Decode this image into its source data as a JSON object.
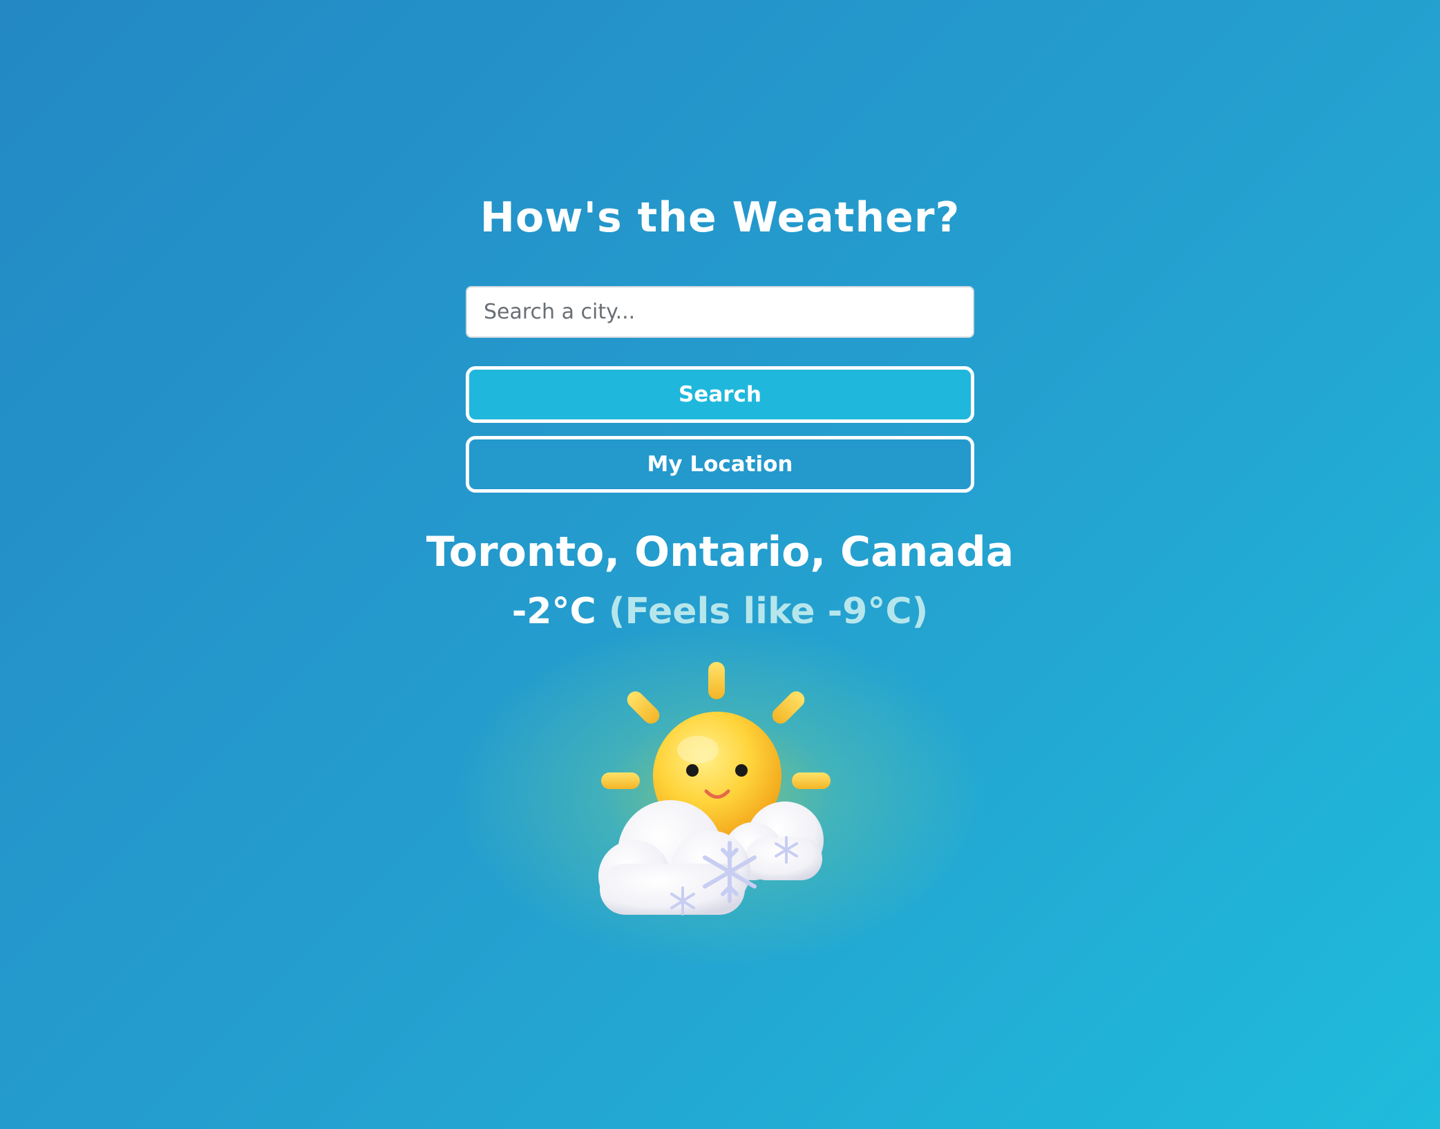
{
  "app": {
    "title": "How's the Weather?"
  },
  "search": {
    "placeholder": "Search a city...",
    "value": ""
  },
  "buttons": {
    "search_label": "Search",
    "location_label": "My Location"
  },
  "weather": {
    "location": "Toronto, Ontario, Canada",
    "temperature": "-2°C",
    "feels_like": "(Feels like -9°C)",
    "icon": "sun-with-snow-clouds-icon"
  },
  "colors": {
    "background_start": "#2388c4",
    "background_end": "#1fbcdc",
    "search_button": "#1fb8dc",
    "feels_like_text": "#b6e6ec",
    "sun": "#ffd43b"
  }
}
